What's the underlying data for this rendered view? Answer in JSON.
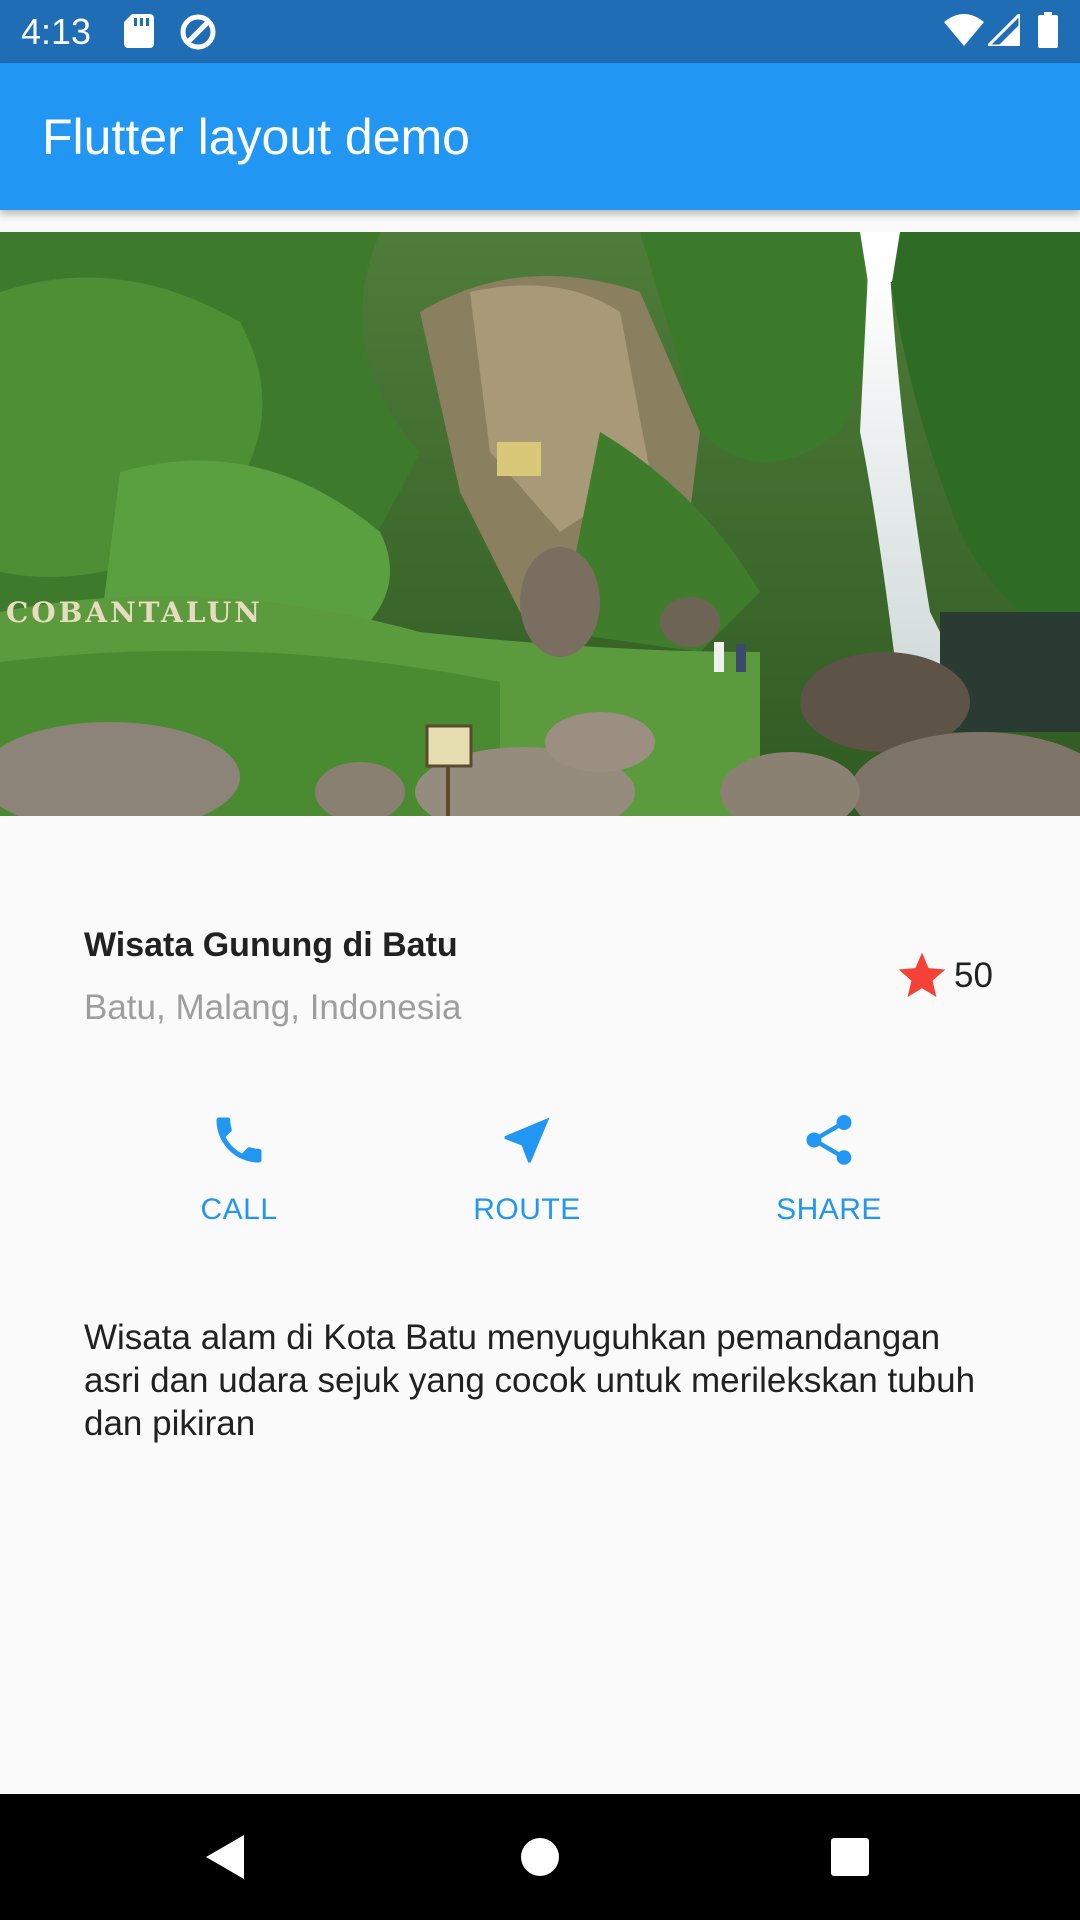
{
  "status_bar": {
    "time": "4:13",
    "icons": [
      "sd-card-icon",
      "data-saver-icon",
      "wifi-icon",
      "signal-icon",
      "battery-icon"
    ],
    "background": "#1f6db5"
  },
  "app_bar": {
    "title": "Flutter layout demo",
    "color": "#2196f3"
  },
  "hero_image": {
    "sign_text": "COBANTALUN"
  },
  "place": {
    "title": "Wisata Gunung di Batu",
    "location": "Batu, Malang, Indonesia",
    "rating_icon": "star-icon",
    "rating_count": "50",
    "star_color": "#f44336"
  },
  "actions": [
    {
      "label": "CALL",
      "icon": "phone-icon"
    },
    {
      "label": "ROUTE",
      "icon": "navigation-icon"
    },
    {
      "label": "SHARE",
      "icon": "share-icon"
    }
  ],
  "accent_color": "#2196f3",
  "description": "Wisata alam di Kota Batu menyuguhkan pemandangan asri dan udara sejuk yang cocok untuk merilekskan tubuh dan pikiran",
  "nav_bar": {
    "buttons": [
      "back-icon",
      "home-icon",
      "recents-icon"
    ]
  }
}
